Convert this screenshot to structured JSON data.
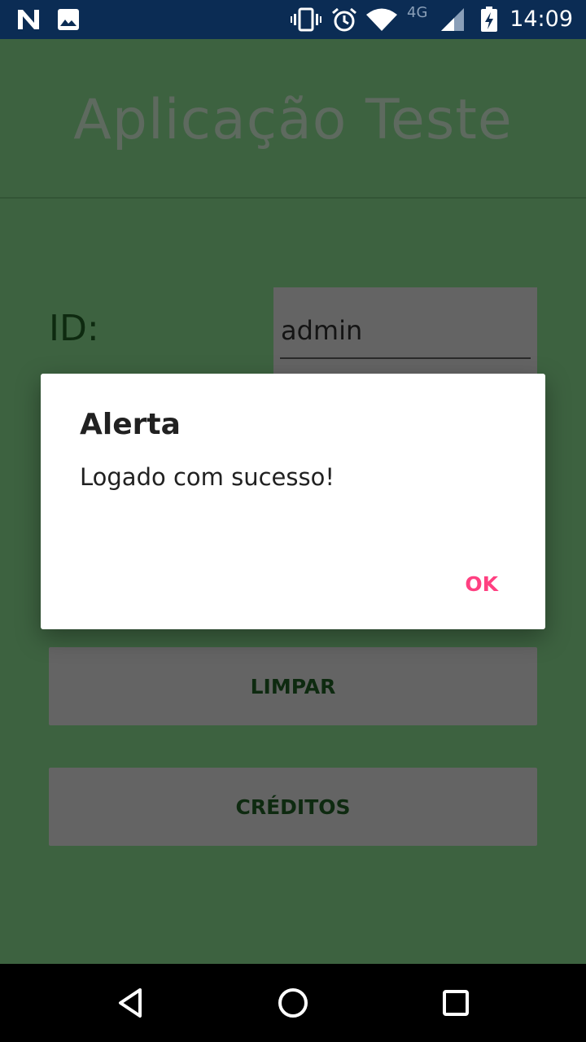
{
  "status_bar": {
    "time": "14:09",
    "network_type": "4G",
    "icons": [
      "n-notification-icon",
      "image-notification-icon",
      "vibrate-icon",
      "alarm-icon",
      "wifi-icon",
      "signal-icon",
      "battery-charging-icon"
    ]
  },
  "app": {
    "title": "Aplicação Teste",
    "id_label": "ID:",
    "id_value": "admin",
    "buttons": {
      "limpar": "LIMPAR",
      "creditos": "CRÉDITOS"
    }
  },
  "dialog": {
    "title": "Alerta",
    "message": "Logado com sucesso!",
    "ok_label": "OK"
  },
  "colors": {
    "background": "#3d6240",
    "status_bar": "#0b2c54",
    "accent": "#ff4081",
    "dialog_bg": "#ffffff"
  },
  "nav_bar": {
    "icons": [
      "back-icon",
      "home-icon",
      "recents-icon"
    ]
  }
}
